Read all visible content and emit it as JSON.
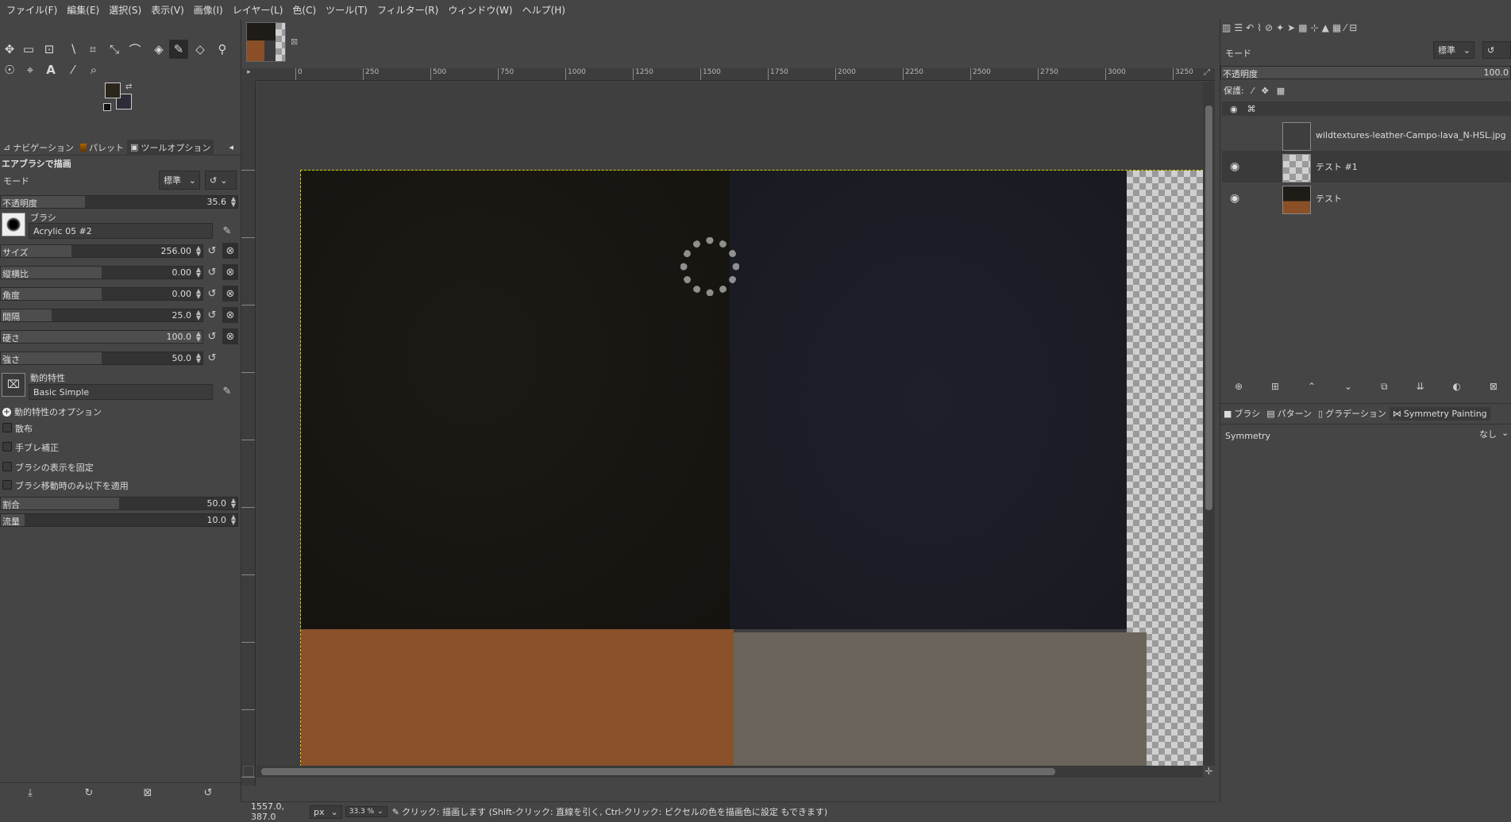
{
  "menubar": [
    "ファイル(F)",
    "編集(E)",
    "選択(S)",
    "表示(V)",
    "画像(I)",
    "レイヤー(L)",
    "色(C)",
    "ツール(T)",
    "フィルター(R)",
    "ウィンドウ(W)",
    "ヘルプ(H)"
  ],
  "colors": {
    "fg": "#2b251c",
    "bg": "#2d2d3a",
    "accent_selection": "#d5d000"
  },
  "toolbox": {
    "tabs": [
      "ナビゲーション",
      "パレット",
      "ツールオプション"
    ],
    "title": "エアブラシで描画",
    "mode_label": "モード",
    "mode_value": "標準",
    "opacity": {
      "label": "不透明度",
      "value": "35.6",
      "fraction": 0.356
    },
    "brush": {
      "label": "ブラシ",
      "value": "Acrylic 05 #2"
    },
    "size": {
      "label": "サイズ",
      "value": "256.00",
      "fraction": 0.35
    },
    "aspect": {
      "label": "縦横比",
      "value": "0.00",
      "fraction": 0.5
    },
    "angle": {
      "label": "角度",
      "value": "0.00",
      "fraction": 0.5
    },
    "spacing": {
      "label": "間隔",
      "value": "25.0",
      "fraction": 0.25
    },
    "hardness": {
      "label": "硬さ",
      "value": "100.0",
      "fraction": 1.0
    },
    "force": {
      "label": "強さ",
      "value": "50.0",
      "fraction": 0.5
    },
    "dynamics": {
      "label": "動的特性",
      "value": "Basic Simple"
    },
    "dynamics_options": "動的特性のオプション",
    "checks": [
      "散布",
      "手ブレ補正",
      "ブラシの表示を固定",
      "ブラシ移動時のみ以下を適用"
    ],
    "rate": {
      "label": "割合",
      "value": "50.0",
      "fraction": 0.5
    },
    "flow": {
      "label": "流量",
      "value": "10.0",
      "fraction": 0.1
    }
  },
  "ruler": {
    "h_ticks": [
      "0",
      "250",
      "500",
      "750",
      "1000",
      "1250",
      "1500",
      "1750",
      "2000",
      "2250",
      "2500",
      "2750",
      "3000",
      "3250"
    ]
  },
  "status": {
    "coords": "1557.0, 387.0",
    "unit": "px",
    "zoom": "33.3 %",
    "message": "クリック: 描画します (Shift-クリック: 直線を引く, Ctrl-クリック: ピクセルの色を描画色に設定 もできます)"
  },
  "layers_panel": {
    "mode_label": "モード",
    "mode_value": "標準",
    "opacity_label": "不透明度",
    "opacity_value": "100.0",
    "lock_label": "保護:",
    "layers": [
      {
        "name": "wildtextures-leather-Campo-lava_N-HSL.jpg",
        "visible": false
      },
      {
        "name": "テスト #1",
        "visible": true
      },
      {
        "name": "テスト",
        "visible": true
      }
    ]
  },
  "bottom_tabs": [
    "ブラシ",
    "パターン",
    "グラデーション",
    "Symmetry Painting"
  ],
  "symmetry": {
    "label": "Symmetry",
    "value": "なし"
  }
}
